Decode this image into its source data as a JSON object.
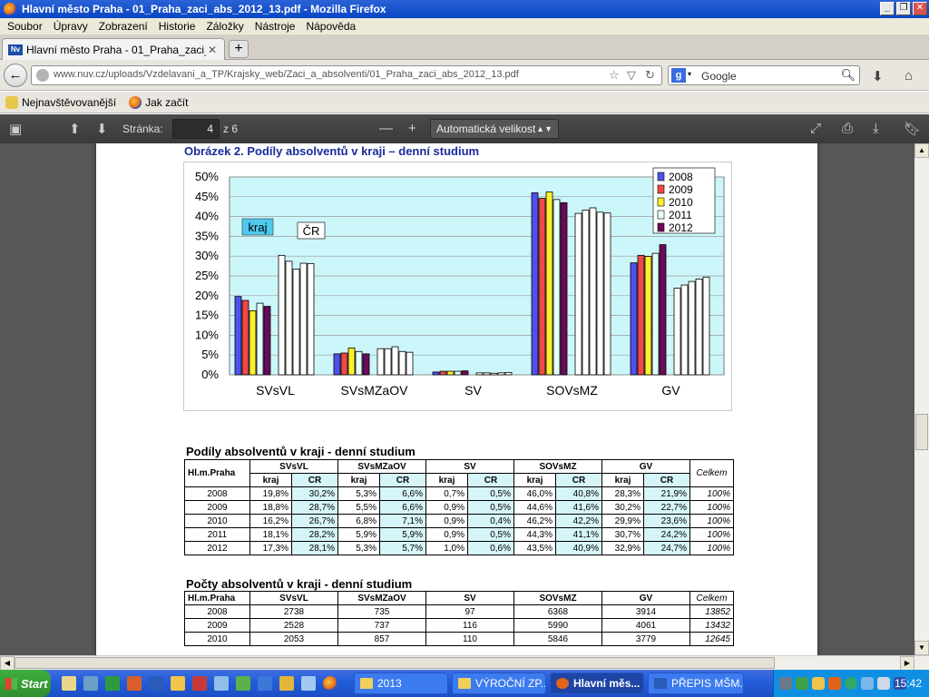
{
  "window": {
    "title": "Hlavní město Praha - 01_Praha_zaci_abs_2012_13.pdf - Mozilla Firefox"
  },
  "menu": [
    "Soubor",
    "Úpravy",
    "Zobrazení",
    "Historie",
    "Záložky",
    "Nástroje",
    "Nápověda"
  ],
  "tab": {
    "label": "Hlavní město Praha - 01_Praha_zaci_abs_20...",
    "favicon": "Nv"
  },
  "nav": {
    "url": "www.nuv.cz/uploads/Vzdelavani_a_TP/Krajsky_web/Zaci_a_absolventi/01_Praha_zaci_abs_2012_13.pdf",
    "search_placeholder": "Google"
  },
  "bookmarks": [
    "Nejnavštěvovanější",
    "Jak začít"
  ],
  "pdf_toolbar": {
    "page_label": "Stránka:",
    "page_value": "4",
    "page_total": "z 6",
    "zoom": "Automatická velikost"
  },
  "doc": {
    "figure_title": "Obrázek 2. Podíly absolventů v kraji – denní studium",
    "table1_title": "Podíly absolventů v kraji - denní studium",
    "table2_title": "Počty absolventů v kraji - denní studium"
  },
  "chart_data": {
    "type": "bar",
    "categories": [
      "SVsVL",
      "SVsMZaOV",
      "SV",
      "SOVsMZ",
      "GV"
    ],
    "ylim": [
      0,
      50
    ],
    "yticks": [
      "0%",
      "5%",
      "10%",
      "15%",
      "20%",
      "25%",
      "30%",
      "35%",
      "40%",
      "45%",
      "50%"
    ],
    "years": [
      "2008",
      "2009",
      "2010",
      "2011",
      "2012"
    ],
    "colors": [
      "#5050ee",
      "#f04848",
      "#fff02a",
      "#e4ffff",
      "#6a0a5a"
    ],
    "kraj": [
      [
        19.8,
        18.8,
        16.2,
        18.1,
        17.3
      ],
      [
        5.3,
        5.5,
        6.8,
        5.9,
        5.3
      ],
      [
        0.7,
        0.9,
        0.9,
        0.9,
        1.0
      ],
      [
        46.0,
        44.6,
        46.2,
        44.3,
        43.5
      ],
      [
        28.3,
        30.2,
        29.9,
        30.7,
        32.9
      ]
    ],
    "cr": [
      [
        30.2,
        28.7,
        26.7,
        28.2,
        28.1
      ],
      [
        6.6,
        6.6,
        7.1,
        5.9,
        5.7
      ],
      [
        0.5,
        0.5,
        0.4,
        0.5,
        0.6
      ],
      [
        40.8,
        41.6,
        42.2,
        41.1,
        40.9
      ],
      [
        21.9,
        22.7,
        23.6,
        24.2,
        24.7
      ]
    ],
    "annotations": [
      "kraj",
      "ČR"
    ],
    "grid": true,
    "legend": "top-right"
  },
  "table1": {
    "corner": "Hl.m.Praha",
    "groups": [
      "SVsVL",
      "SVsMZaOV",
      "SV",
      "SOVsMZ",
      "GV"
    ],
    "total": "Celkem",
    "sub": [
      "kraj",
      "CR"
    ],
    "rows": [
      {
        "year": "2008",
        "vals": [
          "19,8%",
          "30,2%",
          "5,3%",
          "6,6%",
          "0,7%",
          "0,5%",
          "46,0%",
          "40,8%",
          "28,3%",
          "21,9%"
        ],
        "total": "100%"
      },
      {
        "year": "2009",
        "vals": [
          "18,8%",
          "28,7%",
          "5,5%",
          "6,6%",
          "0,9%",
          "0,5%",
          "44,6%",
          "41,6%",
          "30,2%",
          "22,7%"
        ],
        "total": "100%"
      },
      {
        "year": "2010",
        "vals": [
          "16,2%",
          "26,7%",
          "6,8%",
          "7,1%",
          "0,9%",
          "0,4%",
          "46,2%",
          "42,2%",
          "29,9%",
          "23,6%"
        ],
        "total": "100%"
      },
      {
        "year": "2011",
        "vals": [
          "18,1%",
          "28,2%",
          "5,9%",
          "5,9%",
          "0,9%",
          "0,5%",
          "44,3%",
          "41,1%",
          "30,7%",
          "24,2%"
        ],
        "total": "100%"
      },
      {
        "year": "2012",
        "vals": [
          "17,3%",
          "28,1%",
          "5,3%",
          "5,7%",
          "1,0%",
          "0,6%",
          "43,5%",
          "40,9%",
          "32,9%",
          "24,7%"
        ],
        "total": "100%"
      }
    ]
  },
  "table2": {
    "corner": "Hl.m.Praha",
    "groups": [
      "SVsVL",
      "SVsMZaOV",
      "SV",
      "SOVsMZ",
      "GV"
    ],
    "total": "Celkem",
    "rows": [
      {
        "year": "2008",
        "vals": [
          "2738",
          "735",
          "97",
          "6368",
          "3914"
        ],
        "total": "13852"
      },
      {
        "year": "2009",
        "vals": [
          "2528",
          "737",
          "116",
          "5990",
          "4061"
        ],
        "total": "13432"
      },
      {
        "year": "2010",
        "vals": [
          "2053",
          "857",
          "110",
          "5846",
          "3779"
        ],
        "total": "12645"
      }
    ]
  },
  "taskbar": {
    "start": "Start",
    "tasks": [
      "2013",
      "VÝROČNÍ ZP...",
      "Hlavní měs...",
      "PŘEPIS MŠM..."
    ],
    "clock": "15:42"
  }
}
